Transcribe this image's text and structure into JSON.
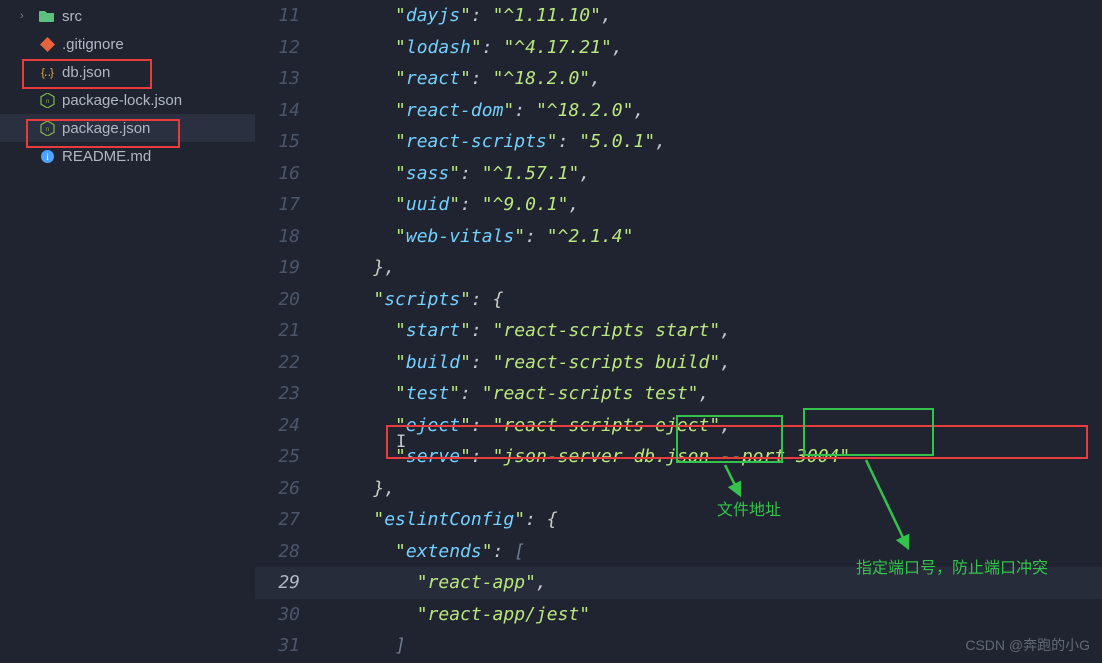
{
  "sidebar": {
    "items": [
      {
        "name": "src",
        "icon": "folder",
        "chevron": true
      },
      {
        "name": ".gitignore",
        "icon": "git"
      },
      {
        "name": "db.json",
        "icon": "json",
        "highlighted": true
      },
      {
        "name": "package-lock.json",
        "icon": "npm"
      },
      {
        "name": "package.json",
        "icon": "npm",
        "selected": true,
        "highlighted": true
      },
      {
        "name": "README.md",
        "icon": "readme"
      }
    ]
  },
  "editor": {
    "startLine": 11,
    "currentLine": 29,
    "lines": [
      {
        "n": 11,
        "indent": 3,
        "tokens": [
          {
            "t": "k",
            "v": "dayjs"
          },
          {
            "t": "c",
            "v": ": "
          },
          {
            "t": "s",
            "v": "^1.11.10"
          },
          {
            "t": "c",
            "v": ","
          }
        ]
      },
      {
        "n": 12,
        "indent": 3,
        "tokens": [
          {
            "t": "k",
            "v": "lodash"
          },
          {
            "t": "c",
            "v": ": "
          },
          {
            "t": "s",
            "v": "^4.17.21"
          },
          {
            "t": "c",
            "v": ","
          }
        ]
      },
      {
        "n": 13,
        "indent": 3,
        "tokens": [
          {
            "t": "k",
            "v": "react"
          },
          {
            "t": "c",
            "v": ": "
          },
          {
            "t": "s",
            "v": "^18.2.0"
          },
          {
            "t": "c",
            "v": ","
          }
        ]
      },
      {
        "n": 14,
        "indent": 3,
        "tokens": [
          {
            "t": "k",
            "v": "react-dom"
          },
          {
            "t": "c",
            "v": ": "
          },
          {
            "t": "s",
            "v": "^18.2.0"
          },
          {
            "t": "c",
            "v": ","
          }
        ]
      },
      {
        "n": 15,
        "indent": 3,
        "tokens": [
          {
            "t": "k",
            "v": "react-scripts"
          },
          {
            "t": "c",
            "v": ": "
          },
          {
            "t": "s",
            "v": "5.0.1"
          },
          {
            "t": "c",
            "v": ","
          }
        ]
      },
      {
        "n": 16,
        "indent": 3,
        "tokens": [
          {
            "t": "k",
            "v": "sass"
          },
          {
            "t": "c",
            "v": ": "
          },
          {
            "t": "s",
            "v": "^1.57.1"
          },
          {
            "t": "c",
            "v": ","
          }
        ]
      },
      {
        "n": 17,
        "indent": 3,
        "tokens": [
          {
            "t": "k",
            "v": "uuid"
          },
          {
            "t": "c",
            "v": ": "
          },
          {
            "t": "s",
            "v": "^9.0.1"
          },
          {
            "t": "c",
            "v": ","
          }
        ]
      },
      {
        "n": 18,
        "indent": 3,
        "tokens": [
          {
            "t": "k",
            "v": "web-vitals"
          },
          {
            "t": "c",
            "v": ": "
          },
          {
            "t": "s",
            "v": "^2.1.4"
          }
        ]
      },
      {
        "n": 19,
        "indent": 2,
        "tokens": [
          {
            "t": "p",
            "v": "}"
          },
          {
            "t": "c",
            "v": ","
          }
        ]
      },
      {
        "n": 20,
        "indent": 2,
        "tokens": [
          {
            "t": "k",
            "v": "scripts"
          },
          {
            "t": "c",
            "v": ": "
          },
          {
            "t": "p",
            "v": "{"
          }
        ]
      },
      {
        "n": 21,
        "indent": 3,
        "tokens": [
          {
            "t": "k",
            "v": "start"
          },
          {
            "t": "c",
            "v": ": "
          },
          {
            "t": "s",
            "v": "react-scripts start"
          },
          {
            "t": "c",
            "v": ","
          }
        ]
      },
      {
        "n": 22,
        "indent": 3,
        "tokens": [
          {
            "t": "k",
            "v": "build"
          },
          {
            "t": "c",
            "v": ": "
          },
          {
            "t": "s",
            "v": "react-scripts build"
          },
          {
            "t": "c",
            "v": ","
          }
        ]
      },
      {
        "n": 23,
        "indent": 3,
        "tokens": [
          {
            "t": "k",
            "v": "test"
          },
          {
            "t": "c",
            "v": ": "
          },
          {
            "t": "s",
            "v": "react-scripts test"
          },
          {
            "t": "c",
            "v": ","
          }
        ]
      },
      {
        "n": 24,
        "indent": 3,
        "tokens": [
          {
            "t": "k",
            "v": "eject"
          },
          {
            "t": "c",
            "v": ": "
          },
          {
            "t": "s",
            "v": "react-scripts eject"
          },
          {
            "t": "c",
            "v": ","
          }
        ]
      },
      {
        "n": 25,
        "indent": 3,
        "tokens": [
          {
            "t": "k",
            "v": "serve"
          },
          {
            "t": "c",
            "v": ": "
          },
          {
            "t": "s",
            "v": "json-server db.json --port 3004"
          }
        ]
      },
      {
        "n": 26,
        "indent": 2,
        "tokens": [
          {
            "t": "p",
            "v": "}"
          },
          {
            "t": "c",
            "v": ","
          }
        ]
      },
      {
        "n": 27,
        "indent": 2,
        "tokens": [
          {
            "t": "k",
            "v": "eslintConfig"
          },
          {
            "t": "c",
            "v": ": "
          },
          {
            "t": "p",
            "v": "{"
          }
        ]
      },
      {
        "n": 28,
        "indent": 3,
        "tokens": [
          {
            "t": "k",
            "v": "extends"
          },
          {
            "t": "c",
            "v": ": "
          },
          {
            "t": "br",
            "v": "["
          }
        ]
      },
      {
        "n": 29,
        "indent": 4,
        "tokens": [
          {
            "t": "s",
            "v": "react-app"
          },
          {
            "t": "c",
            "v": ","
          }
        ]
      },
      {
        "n": 30,
        "indent": 4,
        "tokens": [
          {
            "t": "s",
            "v": "react-app/jest"
          }
        ]
      },
      {
        "n": 31,
        "indent": 3,
        "tokens": [
          {
            "t": "br",
            "v": "]"
          }
        ]
      }
    ]
  },
  "annotations": {
    "label_file": "文件地址",
    "label_port": "指定端口号，防止端口冲突"
  },
  "watermark": "CSDN @奔跑的小G",
  "cursor_glyph": "𝙸"
}
